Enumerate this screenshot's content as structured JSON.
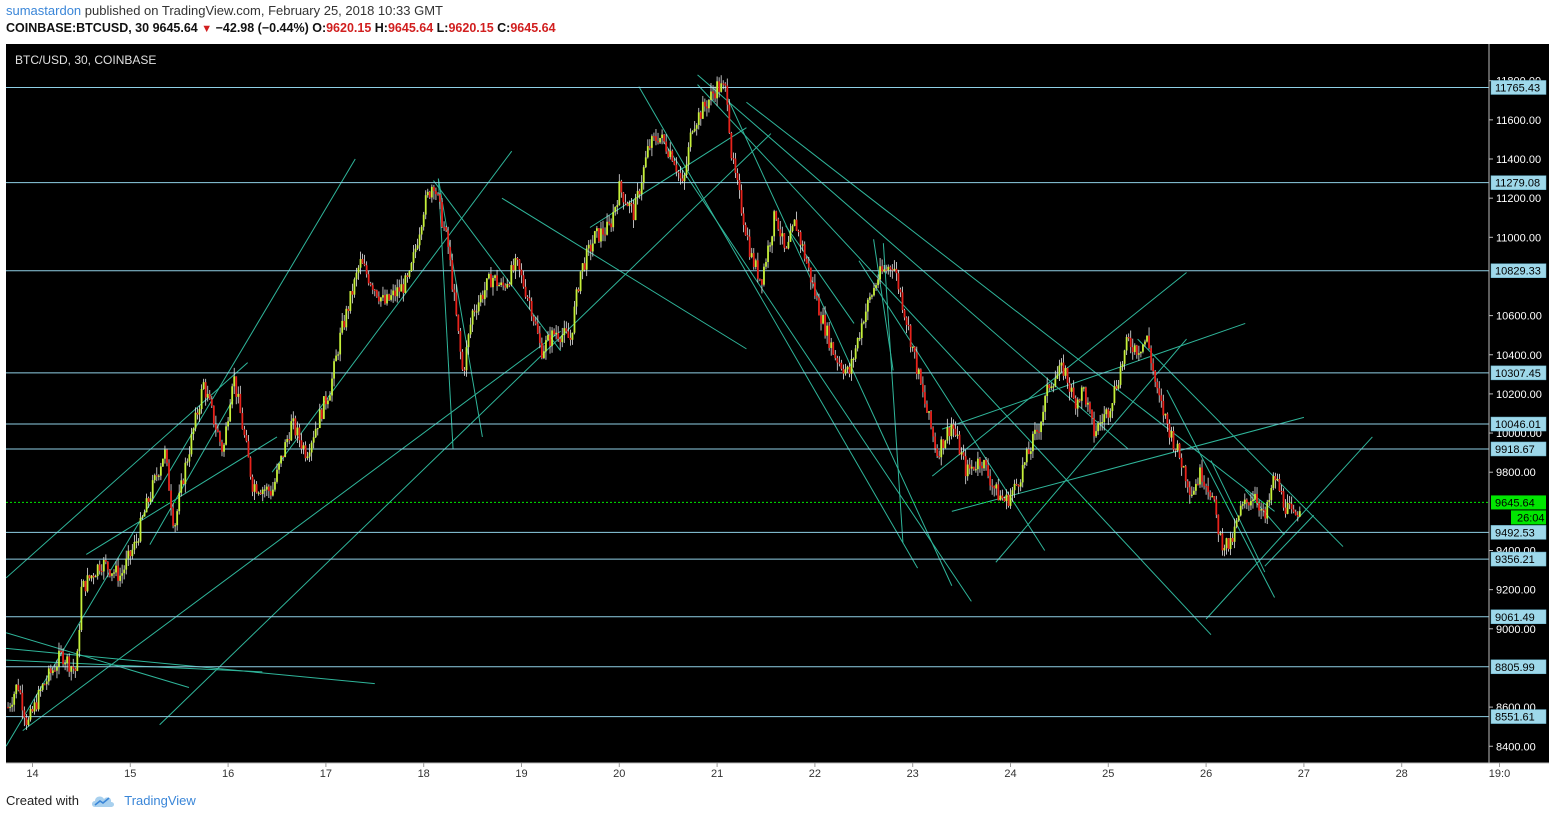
{
  "header": {
    "author": "sumastardon",
    "published_text": " published on TradingView.com, February 25, 2018 10:33 GMT",
    "symbol": "COINBASE:BTCUSD, 30",
    "last": "9645.64",
    "change": "−42.98 (−0.44%)",
    "o_label": "O:",
    "o_value": "9620.15",
    "h_label": "H:",
    "h_value": "9645.64",
    "l_label": "L:",
    "l_value": "9620.15",
    "c_label": "C:",
    "c_value": "9645.64"
  },
  "footer": {
    "created_with": "Created with",
    "brand": "TradingView"
  },
  "colors": {
    "background": "#000000",
    "up": "#c6f03a",
    "down": "#e8231c",
    "line": "#2fb59a",
    "level_line": "#8fd0e6",
    "label_bg": "#9ed8ea",
    "current_price": "#00e600"
  },
  "chart_data": {
    "type": "candlestick",
    "title": "BTC/USD, 30, COINBASE",
    "y_axis": {
      "ylim": [
        8300,
        11850
      ],
      "ticks": [
        "8400.00",
        "8600.00",
        "9000.00",
        "9200.00",
        "9400.00",
        "9800.00",
        "10000.00",
        "10200.00",
        "10400.00",
        "10600.00",
        "11000.00",
        "11200.00",
        "11400.00",
        "11600.00",
        "11800.00"
      ]
    },
    "x_axis": {
      "ticks": [
        "14",
        "15",
        "16",
        "17",
        "18",
        "19",
        "20",
        "21",
        "22",
        "23",
        "24",
        "25",
        "26",
        "27",
        "28",
        "19:0"
      ]
    },
    "levels": [
      11765.43,
      11279.08,
      10829.33,
      10307.45,
      10046.01,
      9918.67,
      9492.53,
      9356.21,
      9061.49,
      8805.99,
      8551.61
    ],
    "level_labels": [
      "11765.43",
      "11279.08",
      "10829.33",
      "10307.45",
      "10046.01",
      "9918.67",
      "9492.53",
      "9356.21",
      "9061.49",
      "8805.99",
      "8551.61"
    ],
    "current_price": 9645.64,
    "current_price_label": "9645.64",
    "countdown_label": "26:04",
    "price_path": [
      {
        "t": 13.75,
        "p": 8600
      },
      {
        "t": 13.85,
        "p": 8720
      },
      {
        "t": 13.95,
        "p": 8510
      },
      {
        "t": 14.1,
        "p": 8700
      },
      {
        "t": 14.3,
        "p": 8870
      },
      {
        "t": 14.45,
        "p": 8780
      },
      {
        "t": 14.5,
        "p": 9200
      },
      {
        "t": 14.7,
        "p": 9340
      },
      {
        "t": 14.9,
        "p": 9270
      },
      {
        "t": 15.05,
        "p": 9430
      },
      {
        "t": 15.15,
        "p": 9600
      },
      {
        "t": 15.35,
        "p": 9910
      },
      {
        "t": 15.45,
        "p": 9520
      },
      {
        "t": 15.55,
        "p": 9800
      },
      {
        "t": 15.75,
        "p": 10250
      },
      {
        "t": 15.95,
        "p": 9900
      },
      {
        "t": 16.05,
        "p": 10310
      },
      {
        "t": 16.25,
        "p": 9740
      },
      {
        "t": 16.45,
        "p": 9700
      },
      {
        "t": 16.65,
        "p": 10050
      },
      {
        "t": 16.8,
        "p": 9900
      },
      {
        "t": 17.05,
        "p": 10240
      },
      {
        "t": 17.15,
        "p": 10500
      },
      {
        "t": 17.35,
        "p": 10870
      },
      {
        "t": 17.6,
        "p": 10660
      },
      {
        "t": 17.85,
        "p": 10780
      },
      {
        "t": 18.0,
        "p": 11150
      },
      {
        "t": 18.1,
        "p": 11290
      },
      {
        "t": 18.25,
        "p": 10950
      },
      {
        "t": 18.4,
        "p": 10300
      },
      {
        "t": 18.5,
        "p": 10620
      },
      {
        "t": 18.7,
        "p": 10800
      },
      {
        "t": 18.8,
        "p": 10740
      },
      {
        "t": 18.95,
        "p": 10860
      },
      {
        "t": 19.1,
        "p": 10650
      },
      {
        "t": 19.2,
        "p": 10420
      },
      {
        "t": 19.35,
        "p": 10520
      },
      {
        "t": 19.5,
        "p": 10480
      },
      {
        "t": 19.6,
        "p": 10820
      },
      {
        "t": 19.75,
        "p": 11000
      },
      {
        "t": 19.9,
        "p": 11050
      },
      {
        "t": 20.0,
        "p": 11250
      },
      {
        "t": 20.15,
        "p": 11120
      },
      {
        "t": 20.3,
        "p": 11460
      },
      {
        "t": 20.4,
        "p": 11520
      },
      {
        "t": 20.55,
        "p": 11420
      },
      {
        "t": 20.65,
        "p": 11250
      },
      {
        "t": 20.75,
        "p": 11580
      },
      {
        "t": 20.85,
        "p": 11650
      },
      {
        "t": 21.0,
        "p": 11770
      },
      {
        "t": 21.1,
        "p": 11750
      },
      {
        "t": 21.15,
        "p": 11400
      },
      {
        "t": 21.25,
        "p": 11150
      },
      {
        "t": 21.35,
        "p": 10900
      },
      {
        "t": 21.45,
        "p": 10780
      },
      {
        "t": 21.6,
        "p": 11130
      },
      {
        "t": 21.7,
        "p": 10900
      },
      {
        "t": 21.8,
        "p": 11080
      },
      {
        "t": 21.9,
        "p": 10900
      },
      {
        "t": 22.05,
        "p": 10620
      },
      {
        "t": 22.2,
        "p": 10400
      },
      {
        "t": 22.35,
        "p": 10300
      },
      {
        "t": 22.5,
        "p": 10600
      },
      {
        "t": 22.65,
        "p": 10800
      },
      {
        "t": 22.8,
        "p": 10870
      },
      {
        "t": 22.95,
        "p": 10550
      },
      {
        "t": 23.1,
        "p": 10200
      },
      {
        "t": 23.25,
        "p": 9900
      },
      {
        "t": 23.4,
        "p": 10050
      },
      {
        "t": 23.55,
        "p": 9800
      },
      {
        "t": 23.7,
        "p": 9870
      },
      {
        "t": 23.85,
        "p": 9700
      },
      {
        "t": 23.95,
        "p": 9650
      },
      {
        "t": 24.05,
        "p": 9720
      },
      {
        "t": 24.15,
        "p": 9850
      },
      {
        "t": 24.3,
        "p": 10050
      },
      {
        "t": 24.4,
        "p": 10260
      },
      {
        "t": 24.55,
        "p": 10330
      },
      {
        "t": 24.65,
        "p": 10160
      },
      {
        "t": 24.75,
        "p": 10220
      },
      {
        "t": 24.85,
        "p": 10000
      },
      {
        "t": 25.0,
        "p": 10120
      },
      {
        "t": 25.1,
        "p": 10280
      },
      {
        "t": 25.2,
        "p": 10470
      },
      {
        "t": 25.3,
        "p": 10430
      },
      {
        "t": 25.4,
        "p": 10480
      },
      {
        "t": 25.5,
        "p": 10200
      },
      {
        "t": 25.6,
        "p": 10050
      },
      {
        "t": 25.75,
        "p": 9850
      },
      {
        "t": 25.85,
        "p": 9700
      },
      {
        "t": 25.95,
        "p": 9800
      },
      {
        "t": 26.05,
        "p": 9700
      },
      {
        "t": 26.15,
        "p": 9450
      },
      {
        "t": 26.25,
        "p": 9420
      },
      {
        "t": 26.35,
        "p": 9600
      },
      {
        "t": 26.5,
        "p": 9700
      },
      {
        "t": 26.6,
        "p": 9550
      },
      {
        "t": 26.7,
        "p": 9780
      },
      {
        "t": 26.8,
        "p": 9640
      },
      {
        "t": 26.9,
        "p": 9560
      },
      {
        "t": 26.97,
        "p": 9645
      }
    ],
    "trendlines": [
      [
        13.73,
        8400,
        17.3,
        11400
      ],
      [
        13.73,
        8900,
        17.5,
        8720
      ],
      [
        13.73,
        8840,
        16.35,
        8780
      ],
      [
        13.73,
        8980,
        15.6,
        8700
      ],
      [
        13.73,
        9260,
        16.2,
        10360
      ],
      [
        15.2,
        9430,
        16.05,
        10170
      ],
      [
        14.55,
        9380,
        16.5,
        9980
      ],
      [
        13.9,
        8480,
        19.4,
        10520
      ],
      [
        15.3,
        8510,
        21.55,
        11530
      ],
      [
        16.45,
        9800,
        18.9,
        11440
      ],
      [
        18.1,
        11290,
        19.4,
        10420
      ],
      [
        18.15,
        11300,
        18.3,
        9920
      ],
      [
        18.15,
        11300,
        18.6,
        9980
      ],
      [
        18.8,
        11200,
        21.3,
        10430
      ],
      [
        19.7,
        11050,
        21.3,
        11560
      ],
      [
        20.2,
        11770,
        23.05,
        9310
      ],
      [
        20.45,
        11490,
        23.6,
        9140
      ],
      [
        20.8,
        11830,
        25.2,
        9920
      ],
      [
        20.8,
        11780,
        26.05,
        8970
      ],
      [
        21.1,
        11720,
        23.4,
        9220
      ],
      [
        21.7,
        11060,
        22.4,
        10560
      ],
      [
        22.45,
        10880,
        24.35,
        9400
      ],
      [
        22.6,
        10990,
        22.8,
        10320
      ],
      [
        22.7,
        10970,
        22.9,
        9440
      ],
      [
        21.3,
        11690,
        26.7,
        9600
      ],
      [
        23.3,
        10020,
        26.4,
        10560
      ],
      [
        23.2,
        9780,
        25.8,
        10820
      ],
      [
        23.4,
        9600,
        27.0,
        10080
      ],
      [
        23.85,
        9340,
        25.8,
        10480
      ],
      [
        25.3,
        10480,
        27.4,
        9420
      ],
      [
        25.6,
        10220,
        26.7,
        9160
      ],
      [
        26.0,
        9050,
        27.7,
        9980
      ],
      [
        26.6,
        9320,
        27.1,
        9580
      ],
      [
        26.05,
        9860,
        26.6,
        9290
      ],
      [
        26.4,
        9710,
        26.8,
        9480
      ]
    ]
  }
}
